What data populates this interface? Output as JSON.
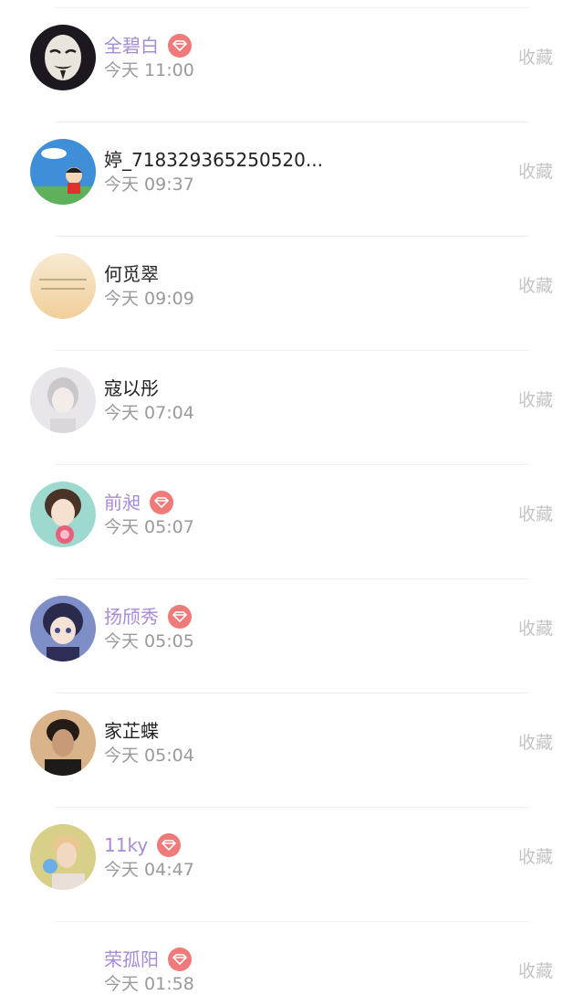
{
  "rows": [
    {
      "name": "全碧白",
      "time": "今天 11:00",
      "action": "收藏",
      "vip": true,
      "avatar_icon": "masked-face-avatar"
    },
    {
      "name": "婷_718329365250520...",
      "time": "今天 09:37",
      "action": "收藏",
      "vip": false,
      "avatar_icon": "cartoon-sky-avatar"
    },
    {
      "name": "何觅翠",
      "time": "今天 09:09",
      "action": "收藏",
      "vip": false,
      "avatar_icon": "text-pastel-avatar"
    },
    {
      "name": "寇以彤",
      "time": "今天 07:04",
      "action": "收藏",
      "vip": false,
      "avatar_icon": "anime-girl-avatar"
    },
    {
      "name": "前昶",
      "time": "今天 05:07",
      "action": "收藏",
      "vip": true,
      "avatar_icon": "lollipop-girl-avatar"
    },
    {
      "name": "扬颀秀",
      "time": "今天 05:05",
      "action": "收藏",
      "vip": true,
      "avatar_icon": "anime-boy-avatar"
    },
    {
      "name": "家芷蝶",
      "time": "今天 05:04",
      "action": "收藏",
      "vip": false,
      "avatar_icon": "photo-person-avatar"
    },
    {
      "name": "11ky",
      "time": "今天 04:47",
      "action": "收藏",
      "vip": true,
      "avatar_icon": "photo-flower-avatar"
    },
    {
      "name": "荣孤阳",
      "time": "今天 01:58",
      "action": "收藏",
      "vip": true,
      "avatar_icon": "blank-avatar"
    }
  ],
  "colors": {
    "vip_name": "#a78bd6",
    "vip_badge": "#ef7a7a",
    "name": "#222222",
    "time": "#9a9a9a",
    "action": "#c4c4c4",
    "divider": "#f0f0f0"
  }
}
